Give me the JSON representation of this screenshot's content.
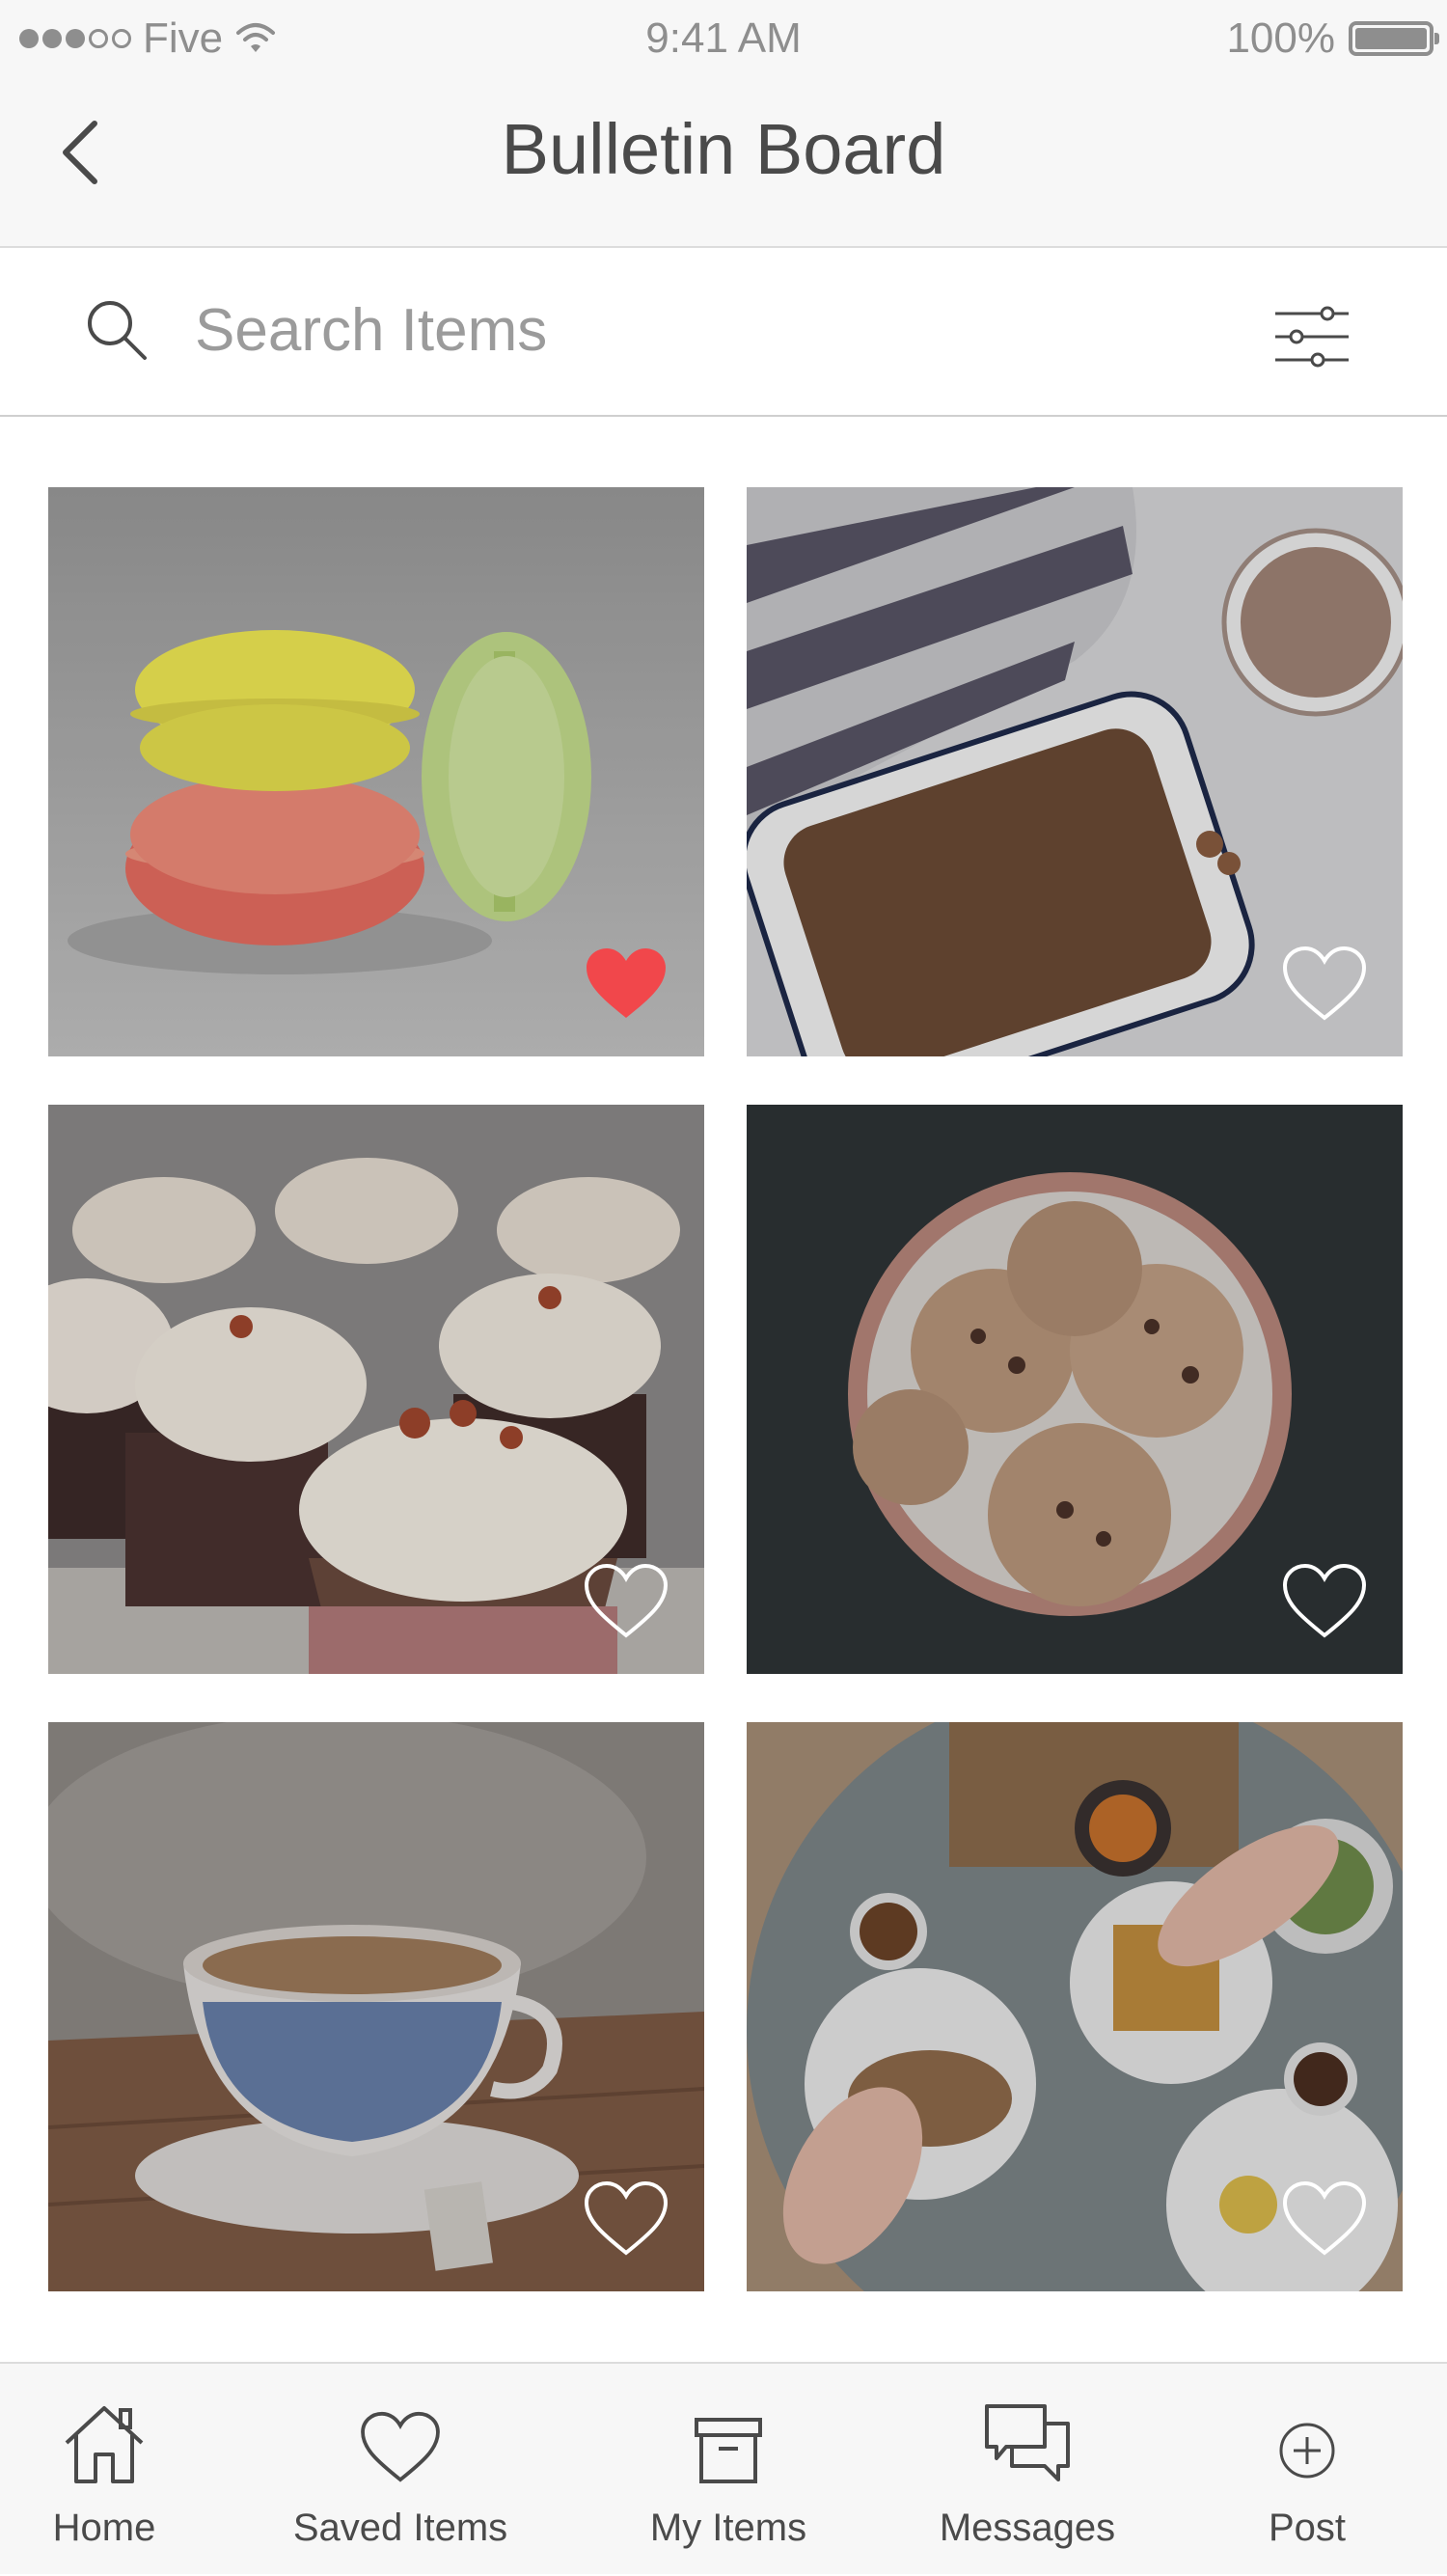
{
  "status_bar": {
    "carrier": "Five",
    "time": "9:41 AM",
    "battery": "100%"
  },
  "header": {
    "title": "Bulletin Board"
  },
  "search": {
    "placeholder": "Search Items"
  },
  "items": [
    {
      "subject": "macarons",
      "favorited": true
    },
    {
      "subject": "granola and coffee",
      "favorited": false
    },
    {
      "subject": "cupcakes",
      "favorited": false
    },
    {
      "subject": "chocolate chip cookies",
      "favorited": false
    },
    {
      "subject": "tea cup",
      "favorited": false
    },
    {
      "subject": "brunch table",
      "favorited": false
    }
  ],
  "tabs": [
    {
      "label": "Home",
      "icon": "home-icon"
    },
    {
      "label": "Saved Items",
      "icon": "heart-icon"
    },
    {
      "label": "My Items",
      "icon": "box-icon"
    },
    {
      "label": "Messages",
      "icon": "chat-icon"
    },
    {
      "label": "Post",
      "icon": "plus-circle-icon"
    }
  ],
  "colors": {
    "favorite_red": "#f1474b",
    "text": "#4a4a4a",
    "placeholder": "#9b9b9b"
  }
}
